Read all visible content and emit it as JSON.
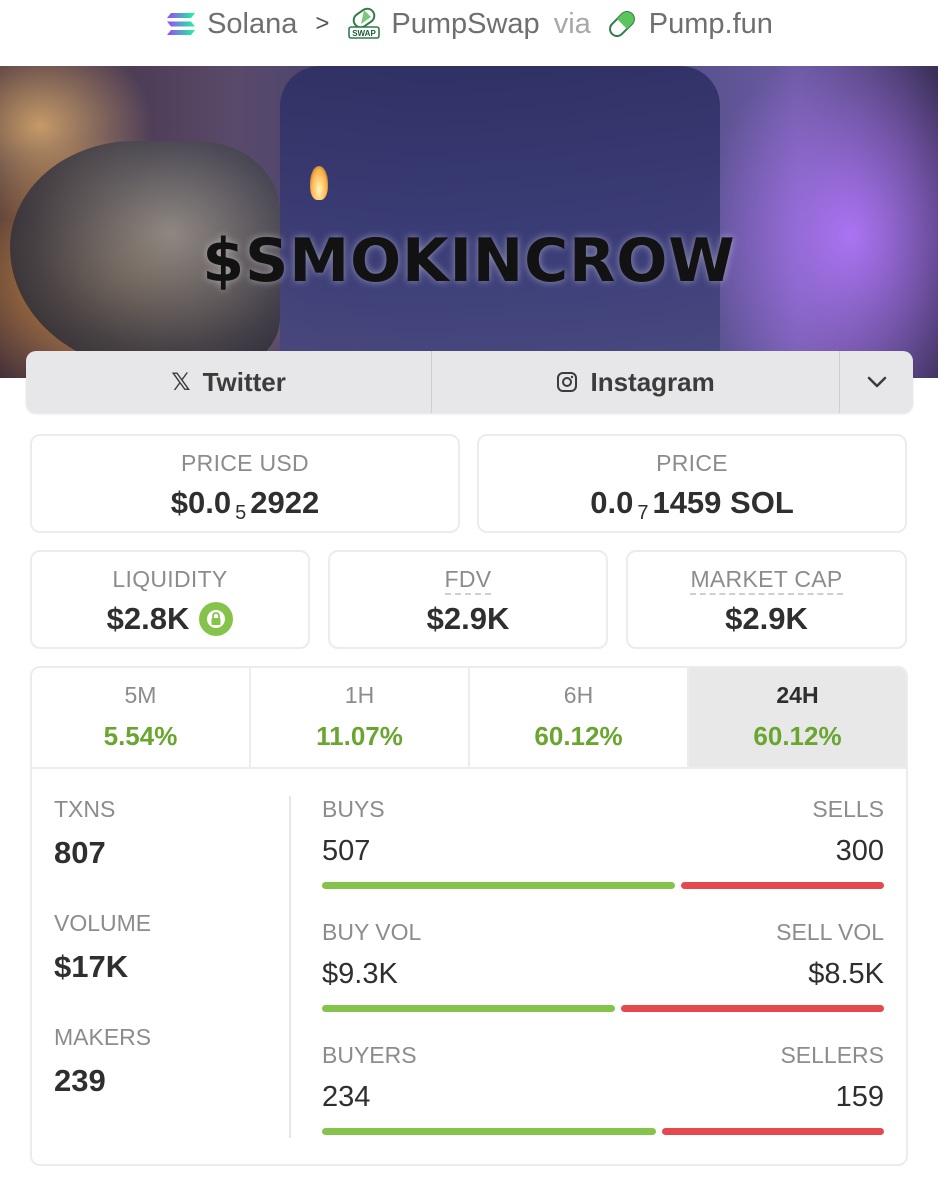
{
  "breadcrumb": {
    "chain": "Solana",
    "dex": "PumpSwap",
    "via": "via",
    "launchpad": "Pump.fun",
    "swap_badge": "SWAP"
  },
  "banner": {
    "ticker": "$SMOKINCROW"
  },
  "socials": {
    "twitter": "Twitter",
    "instagram": "Instagram",
    "twitter_glyph": "𝕏"
  },
  "price": {
    "usd_label": "PRICE USD",
    "usd_prefix": "$0.0",
    "usd_zeros": "5",
    "usd_digits": "2922",
    "native_label": "PRICE",
    "native_prefix": "0.0",
    "native_zeros": "7",
    "native_digits": "1459 SOL"
  },
  "metrics": {
    "liquidity_label": "LIQUIDITY",
    "liquidity_value": "$2.8K",
    "fdv_label": "FDV",
    "fdv_value": "$2.9K",
    "mcap_label": "MARKET CAP",
    "mcap_value": "$2.9K"
  },
  "timeframes": [
    {
      "label": "5M",
      "change": "5.54%"
    },
    {
      "label": "1H",
      "change": "11.07%"
    },
    {
      "label": "6H",
      "change": "60.12%"
    },
    {
      "label": "24H",
      "change": "60.12%",
      "active": true
    }
  ],
  "stats": {
    "txns_label": "TXNS",
    "txns": "807",
    "volume_label": "VOLUME",
    "volume": "$17K",
    "makers_label": "MAKERS",
    "makers": "239",
    "buys_label": "BUYS",
    "buys": "507",
    "sells_label": "SELLS",
    "sells": "300",
    "buy_vol_label": "BUY VOL",
    "buy_vol": "$9.3K",
    "sell_vol_label": "SELL VOL",
    "sell_vol": "$8.5K",
    "buyers_label": "BUYERS",
    "buyers": "234",
    "sellers_label": "SELLERS",
    "sellers": "159"
  },
  "ratios": {
    "buys_share": 0.628,
    "buy_vol_share": 0.522,
    "buyers_share": 0.595
  },
  "colors": {
    "positive": "#6aa62f",
    "buy_bar": "#86c34a",
    "sell_bar": "#e5484d"
  },
  "icons": [
    "solana-icon",
    "chevron-right-icon",
    "pumpswap-icon",
    "pill-icon",
    "x-icon",
    "instagram-icon",
    "chevron-down-icon",
    "lock-icon"
  ]
}
